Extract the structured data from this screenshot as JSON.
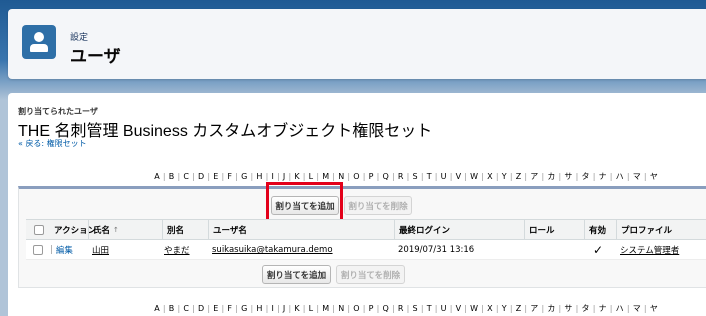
{
  "header": {
    "breadcrumb": "設定",
    "title": "ユーザ"
  },
  "page": {
    "assigned_label": "割り当てられたユーザ",
    "title": "THE 名刺管理 Business カスタムオブジェクト権限セット",
    "back_link": "« 戻る: 権限セット"
  },
  "alphabet": [
    "A",
    "B",
    "C",
    "D",
    "E",
    "F",
    "G",
    "H",
    "I",
    "J",
    "K",
    "L",
    "M",
    "N",
    "O",
    "P",
    "Q",
    "R",
    "S",
    "T",
    "U",
    "V",
    "W",
    "X",
    "Y",
    "Z",
    "ア",
    "カ",
    "サ",
    "タ",
    "ナ",
    "ハ",
    "マ",
    "ヤ"
  ],
  "buttons": {
    "add_assignment": "割り当てを追加",
    "remove_assignment": "割り当てを削除"
  },
  "table": {
    "columns": {
      "action": "アクション",
      "name": "氏名",
      "alias": "別名",
      "username": "ユーザ名",
      "last_login": "最終ログイン",
      "role": "ロール",
      "active": "有効",
      "profile": "プロファイル"
    },
    "sort_indicator": "↑",
    "rows": [
      {
        "action": "編集",
        "name": "山田",
        "alias": "やまだ",
        "username": "suikasuika@takamura.demo",
        "last_login": "2019/07/31 13:16",
        "role": "",
        "active": "✓",
        "profile": "システム管理者"
      }
    ]
  },
  "colors": {
    "accent": "#2e6fa7",
    "highlight_box": "#e3001a",
    "link": "#015ba7"
  }
}
